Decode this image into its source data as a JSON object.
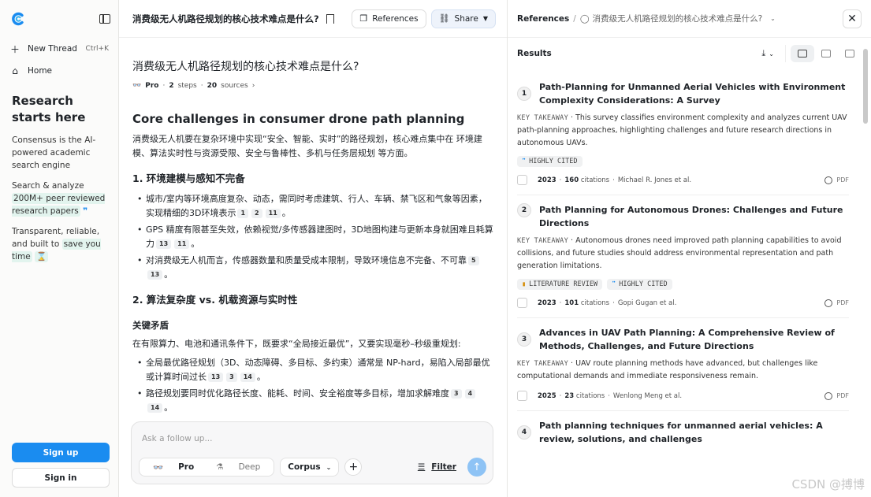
{
  "sidebar": {
    "new_thread": "New Thread",
    "new_thread_kbd": "Ctrl+K",
    "home": "Home",
    "title_line1": "Research",
    "title_line2": "starts here",
    "desc1": "Consensus is the AI-powered academic search engine",
    "desc2_prefix": "Search & analyze",
    "desc2_hl": "200M+ peer reviewed research papers",
    "desc3_prefix": "Transparent, reliable, and built to",
    "desc3_hl": "save you time",
    "signup": "Sign up",
    "signin": "Sign in"
  },
  "main": {
    "header_title": "消费级无人机路径规划的核心技术难点是什么?",
    "references_label": "References",
    "share_label": "Share",
    "question": "消费级无人机路径规划的核心技术难点是什么?",
    "meta_mode": "Pro",
    "meta_steps_num": "2",
    "meta_steps_label": "steps",
    "meta_sources_num": "20",
    "meta_sources_label": "sources",
    "heading": "Core challenges in consumer drone path planning",
    "intro": "消费级无人机要在复杂环境中实现“安全、智能、实时”的路径规划，核心难点集中在 环境建模、算法实时性与资源受限、安全与鲁棒性、多机与任务层规划 等方面。",
    "section1": "1. 环境建模与感知不完备",
    "s1_b1": "城市/室内等环境高度复杂、动态，需同时考虑建筑、行人、车辆、禁飞区和气象等因素，实现精细的3D环境表示",
    "s1_b1_c": [
      "1",
      "2",
      "11"
    ],
    "s1_b2": "GPS 精度有限甚至失效，依赖视觉/多传感器建图时，3D地图构建与更新本身就困难且耗算力",
    "s1_b2_c": [
      "13",
      "11"
    ],
    "s1_b3": "对消费级无人机而言，传感器数量和质量受成本限制，导致环境信息不完备、不可靠",
    "s1_b3_c": [
      "5",
      "13"
    ],
    "section2": "2. 算法复杂度 vs. 机载资源与实时性",
    "sub": "关键矛盾",
    "s2_para": "在有限算力、电池和通讯条件下，既要求“全局接近最优”，又要实现毫秒–秒级重规划:",
    "s2_b1": "全局最优路径规划（3D、动态障碍、多目标、多约束）通常是 NP-hard，易陷入局部最优或计算时间过长",
    "s2_b1_c": [
      "13",
      "3",
      "14"
    ],
    "s2_b2": "路径规划要同时优化路径长度、能耗、时间、安全裕度等多目标，增加求解难度",
    "s2_b2_c": [
      "3",
      "4",
      "14"
    ],
    "input_placeholder": "Ask a follow up...",
    "mode_pro": "Pro",
    "mode_deep": "Deep",
    "corpus": "Corpus",
    "filter": "Filter"
  },
  "panel": {
    "crumb_root": "References",
    "crumb_sep": "/",
    "crumb_query": "消费级无人机路径规划的核心技术难点是什么?",
    "results_label": "Results",
    "cards": [
      {
        "num": "1",
        "title": "Path-Planning for Unmanned Aerial Vehicles with Environment Complexity Considerations: A Survey",
        "takeaway_label": "KEY TAKEAWAY",
        "takeaway": "This survey classifies environment complexity and analyzes current UAV path-planning approaches, highlighting challenges and future research directions in autonomous UAVs.",
        "badges": [
          "HIGHLY CITED"
        ],
        "year": "2023",
        "citations_num": "160",
        "citations_label": "citations",
        "author": "Michael R. Jones et al.",
        "pdf": "PDF"
      },
      {
        "num": "2",
        "title": "Path Planning for Autonomous Drones: Challenges and Future Directions",
        "takeaway_label": "KEY TAKEAWAY",
        "takeaway": "Autonomous drones need improved path planning capabilities to avoid collisions, and future studies should address environmental representation and path generation limitations.",
        "badges": [
          "LITERATURE REVIEW",
          "HIGHLY CITED"
        ],
        "year": "2023",
        "citations_num": "101",
        "citations_label": "citations",
        "author": "Gopi Gugan et al.",
        "pdf": "PDF"
      },
      {
        "num": "3",
        "title": "Advances in UAV Path Planning: A Comprehensive Review of Methods, Challenges, and Future Directions",
        "takeaway_label": "KEY TAKEAWAY",
        "takeaway": "UAV route planning methods have advanced, but challenges like computational demands and immediate responsiveness remain.",
        "badges": [],
        "year": "2025",
        "citations_num": "23",
        "citations_label": "citations",
        "author": "Wenlong Meng et al.",
        "pdf": "PDF"
      },
      {
        "num": "4",
        "title": "Path planning techniques for unmanned aerial vehicles: A review, solutions, and challenges"
      }
    ]
  },
  "watermark": "CSDN @搏博",
  "colors": {
    "accent": "#1a8cf0",
    "highlight": "#e2f4ee",
    "send": "#8ec3f5"
  }
}
